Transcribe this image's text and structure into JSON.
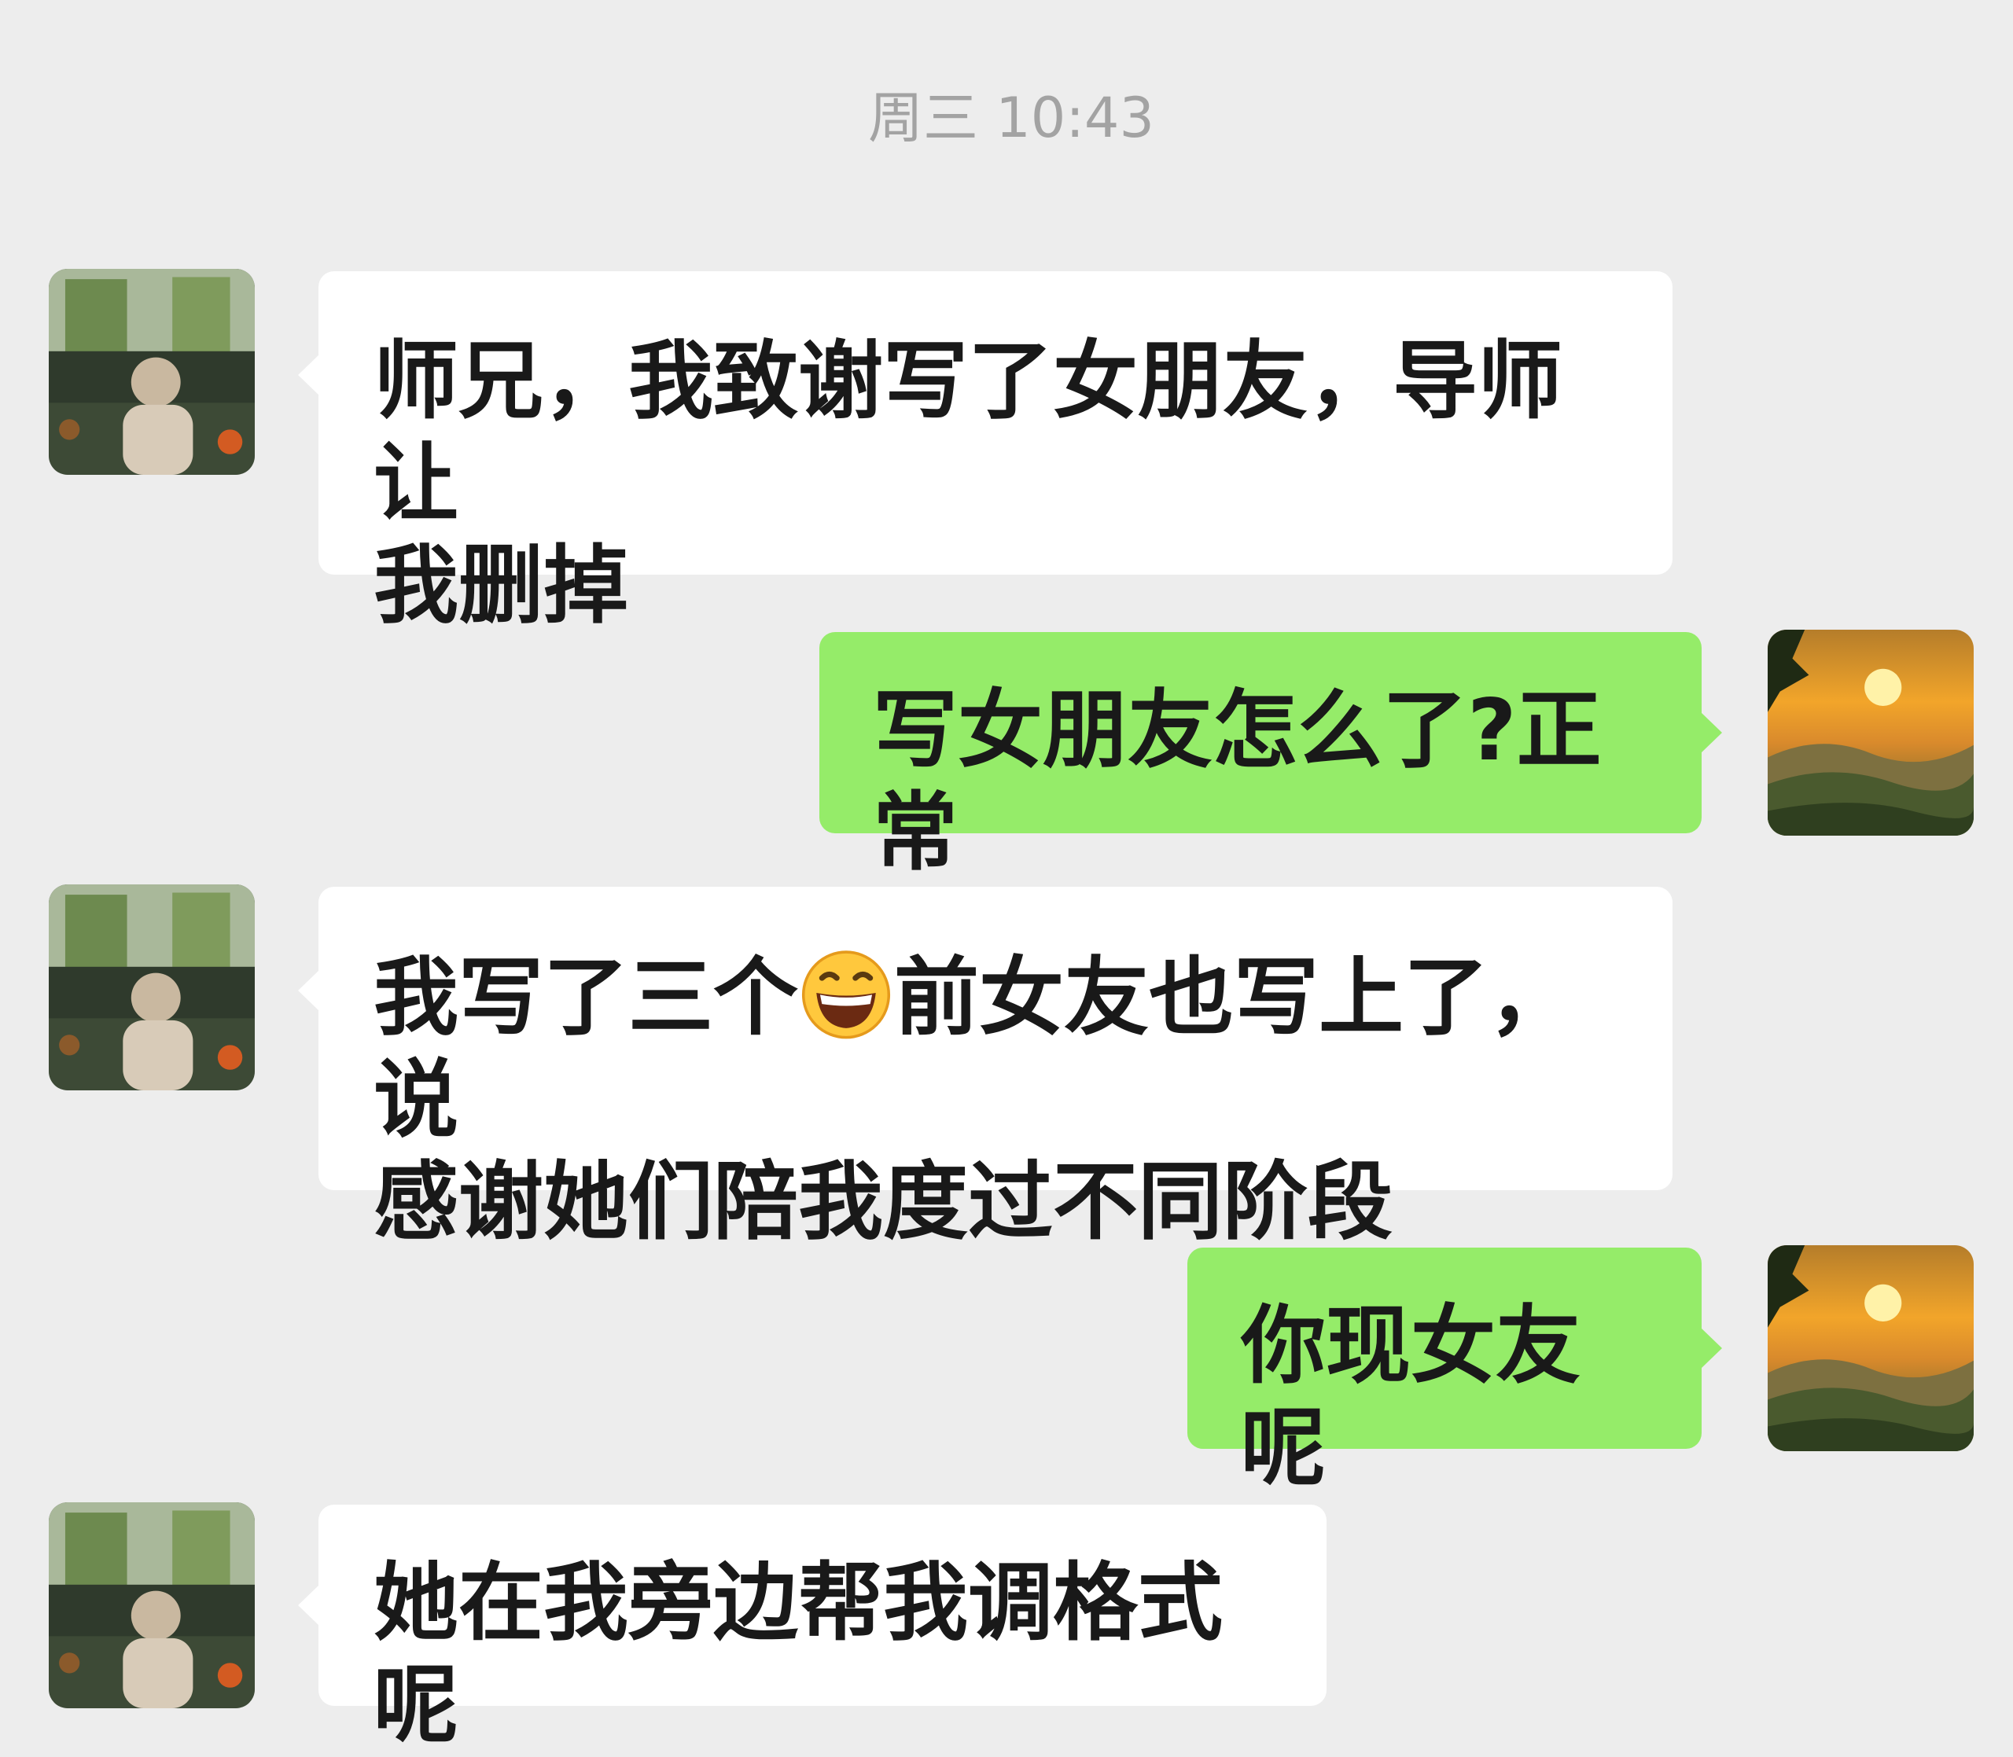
{
  "chat": {
    "timestamp": "周三 10:43",
    "colors": {
      "background": "#ededed",
      "incoming_bubble": "#ffffff",
      "outgoing_bubble": "#95ec69",
      "text": "#191919",
      "timestamp": "#a3a3a3"
    },
    "messages": [
      {
        "sender": "other",
        "avatar": "person-photo-avatar",
        "text": "师兄，我致谢写了女朋友，导师让\n我删掉"
      },
      {
        "sender": "me",
        "avatar": "sunset-mountains-avatar",
        "text": "写女朋友怎么了?正常"
      },
      {
        "sender": "other",
        "avatar": "person-photo-avatar",
        "text_before_emoji": "我写了三个",
        "emoji": "grinning-face-emoji",
        "text_after_emoji": "前女友也写上了，说\n感谢她们陪我度过不同阶段"
      },
      {
        "sender": "me",
        "avatar": "sunset-mountains-avatar",
        "text": "你现女友呢"
      },
      {
        "sender": "other",
        "avatar": "person-photo-avatar",
        "text": "她在我旁边帮我调格式呢"
      }
    ]
  }
}
